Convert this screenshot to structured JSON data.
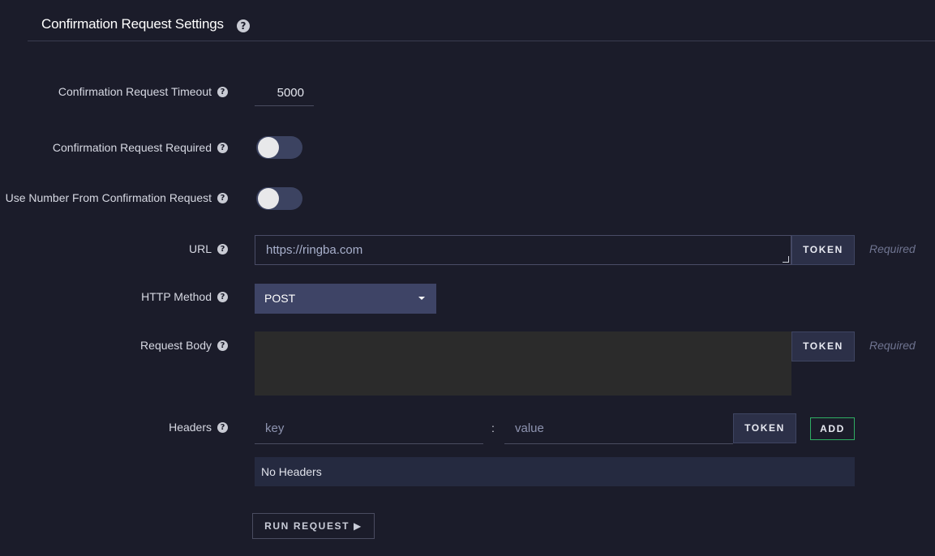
{
  "section": {
    "title": "Confirmation Request Settings",
    "help_icon": "question-circle-icon"
  },
  "fields": {
    "timeout": {
      "label": "Confirmation Request Timeout",
      "value": "5000"
    },
    "required": {
      "label": "Confirmation Request Required",
      "enabled": false
    },
    "use_number": {
      "label": "Use Number From Confirmation Request",
      "enabled": false
    },
    "url": {
      "label": "URL",
      "value": "https://ringba.com",
      "token_label": "TOKEN",
      "required_text": "Required"
    },
    "http_method": {
      "label": "HTTP Method",
      "selected": "POST"
    },
    "request_body": {
      "label": "Request Body",
      "value": "",
      "token_label": "TOKEN",
      "required_text": "Required"
    },
    "headers": {
      "label": "Headers",
      "key_placeholder": "key",
      "separator": ":",
      "value_placeholder": "value",
      "token_label": "TOKEN",
      "add_label": "ADD",
      "empty_text": "No Headers"
    }
  },
  "actions": {
    "run_request_label": "RUN REQUEST ▶"
  },
  "colors": {
    "background": "#1b1c2a",
    "toggle_track": "#3c4361",
    "select_bg": "#3e4466",
    "add_border": "#2fae63"
  }
}
